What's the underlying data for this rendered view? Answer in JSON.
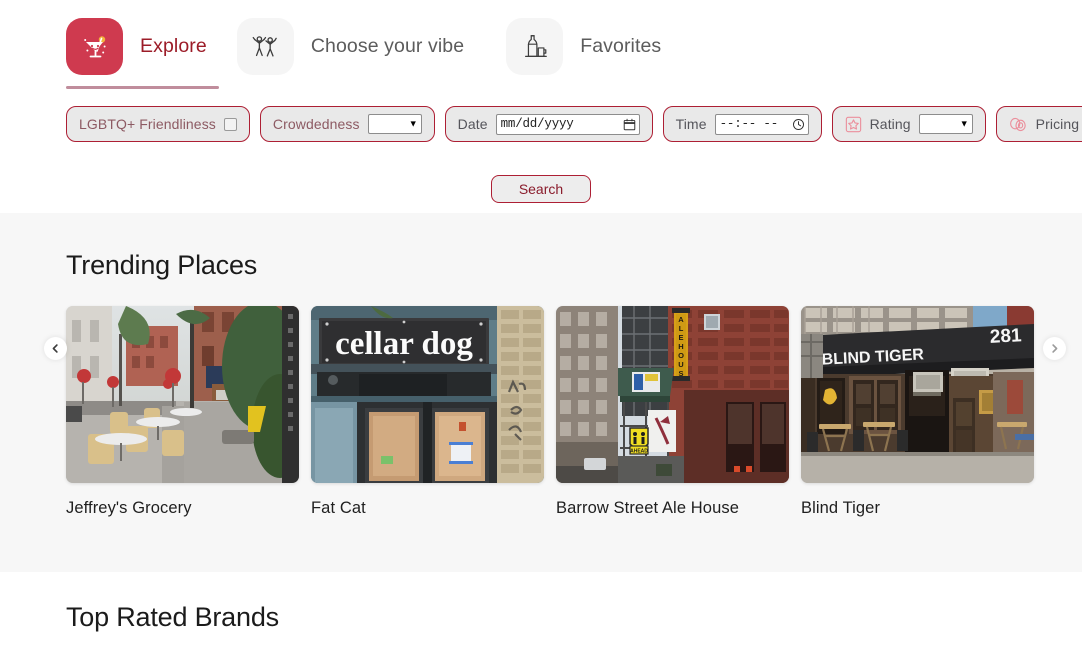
{
  "nav": {
    "tabs": [
      {
        "id": "explore",
        "label": "Explore",
        "icon": "cocktail-icon",
        "active": true
      },
      {
        "id": "vibe",
        "label": "Choose your vibe",
        "icon": "dancing-people-icon",
        "active": false
      },
      {
        "id": "favorites",
        "label": "Favorites",
        "icon": "bottle-glass-icon",
        "active": false
      }
    ]
  },
  "filters": {
    "lgbtq": {
      "label": "LGBTQ+ Friendliness",
      "control": "checkbox",
      "checked": false
    },
    "crowdedness": {
      "label": "Crowdedness",
      "control": "select",
      "value": "",
      "options": [
        ""
      ]
    },
    "date": {
      "label": "Date",
      "control": "date",
      "placeholder": "mm/dd/yyyy",
      "value": "",
      "icon": "calendar-icon"
    },
    "time": {
      "label": "Time",
      "control": "time",
      "placeholder": "--:-- --",
      "value": "",
      "icon": "clock-icon"
    },
    "rating": {
      "label": "Rating",
      "control": "select",
      "value": "",
      "options": [
        ""
      ],
      "icon": "star-box-icon"
    },
    "pricing": {
      "label": "Pricing",
      "control": "select",
      "value": "",
      "options": [
        ""
      ],
      "icon": "coins-icon"
    }
  },
  "search": {
    "label": "Search"
  },
  "trending": {
    "title": "Trending Places",
    "prev_label": "‹",
    "next_label": "›",
    "cards": [
      {
        "name": "Jeffrey's Grocery",
        "image": "street-cafe-tables-photo"
      },
      {
        "name": "Fat Cat",
        "image": "cellar-dog-storefront-photo"
      },
      {
        "name": "Barrow Street Ale House",
        "image": "alehouse-vertical-sign-photo"
      },
      {
        "name": "Blind Tiger",
        "image": "blind-tiger-awning-photo"
      }
    ]
  },
  "top_rated": {
    "title": "Top Rated Brands"
  },
  "colors": {
    "accent": "#cf3a4f",
    "accent_dark": "#9c1c28",
    "border_red": "#ad1f34",
    "pill_bg": "#e9e9e9",
    "section_bg": "#f7f7f7",
    "underline": "#c08d9c"
  }
}
